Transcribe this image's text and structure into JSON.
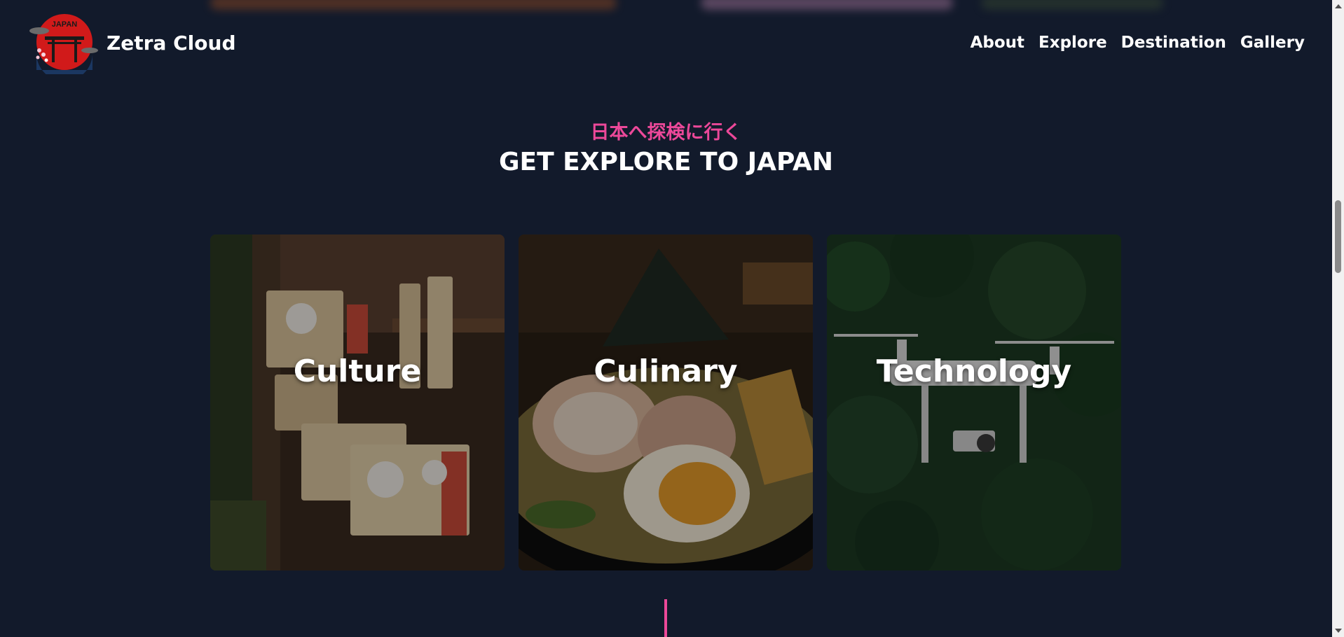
{
  "header": {
    "brand_name": "Zetra Cloud",
    "logo_text": "JAPAN",
    "nav": [
      {
        "label": "About"
      },
      {
        "label": "Explore"
      },
      {
        "label": "Destination"
      },
      {
        "label": "Gallery"
      }
    ]
  },
  "section": {
    "subtitle": "日本へ探検に行く",
    "title": "GET EXPLORE TO JAPAN"
  },
  "cards": [
    {
      "label": "Culture"
    },
    {
      "label": "Culinary"
    },
    {
      "label": "Technology"
    }
  ],
  "colors": {
    "background": "#121a2b",
    "accent": "#ec4899",
    "text": "#ffffff"
  }
}
